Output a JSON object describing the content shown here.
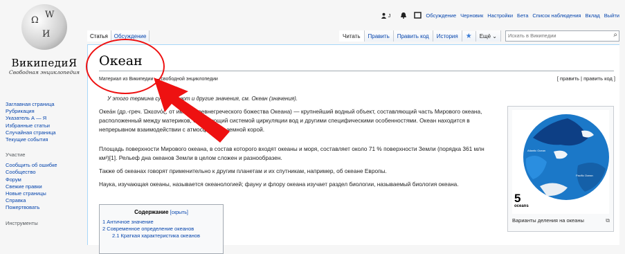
{
  "logo": {
    "title": "ВикипедиЯ",
    "subtitle": "Свободная энциклопедия",
    "globe_glyphs": [
      "Ω",
      "W",
      "И"
    ]
  },
  "personal": {
    "user": "J",
    "links": [
      "Обсуждение",
      "Черновик",
      "Настройки",
      "Бета",
      "Список наблюдения",
      "Вклад",
      "Выйти"
    ]
  },
  "sidebar": {
    "nav": [
      "Заглавная страница",
      "Рубрикация",
      "Указатель А — Я",
      "Избранные статьи",
      "Случайная страница",
      "Текущие события"
    ],
    "participation_heading": "Участие",
    "participation": [
      "Сообщить об ошибке",
      "Сообщество",
      "Форум",
      "Свежие правки",
      "Новые страницы",
      "Справка",
      "Пожертвовать"
    ],
    "tools_heading": "Инструменты"
  },
  "tabs": {
    "left": [
      "Статья",
      "Обсуждение"
    ],
    "right": [
      "Читать",
      "Править",
      "Править код",
      "История"
    ],
    "more": "Ещё",
    "search_placeholder": "Искать в Википедии"
  },
  "article": {
    "title": "Океан",
    "subtitle": "Материал из Википедии — свободной энциклопедии",
    "edit_links": "[ править | править код ]",
    "hatnote": "У этого термина существуют и другие значения, см. Океан (значения).",
    "p1": "Океа́н (др.-греч. Ὠκεανός, от имени древнегреческого божества Океана) — крупнейший водный объект, составляющий часть Мирового океана, расположенный между материков, обладающий системой циркуляции вод и другими специфическими особенностями. Океан находится в непрерывном взаимодействии с атмосферой и земной корой.",
    "p2": "Площадь поверхности Мирового океана, в состав которого входят океаны и моря, составляет около 71 % поверхности Земли (порядка 361 млн км²)[1]. Рельеф дна океанов Земли в целом сложен и разнообразен.",
    "p3": "Также об океанах говорят применительно к другим планетам и их спутникам, например, об океане Европы.",
    "p4": "Наука, изучающая океаны, называется океанологией; фауну и флору океана изучает раздел биологии, называемый биология океана."
  },
  "toc": {
    "title": "Содержание",
    "toggle": "[скрыть]",
    "items": [
      "1 Античное значение",
      "2 Современное определение океанов",
      "2.1 Краткая характеристика океанов"
    ]
  },
  "infobox": {
    "number": "5",
    "unit": "oceans",
    "caption": "Варианты деления на океаны",
    "map_labels": [
      "Atlantic Ocean",
      "Pacific Ocean"
    ]
  },
  "colors": {
    "link": "#0645ad",
    "annotation": "#ee1111",
    "ocean": "#1b78c8",
    "ocean_dark": "#0d3f85"
  }
}
